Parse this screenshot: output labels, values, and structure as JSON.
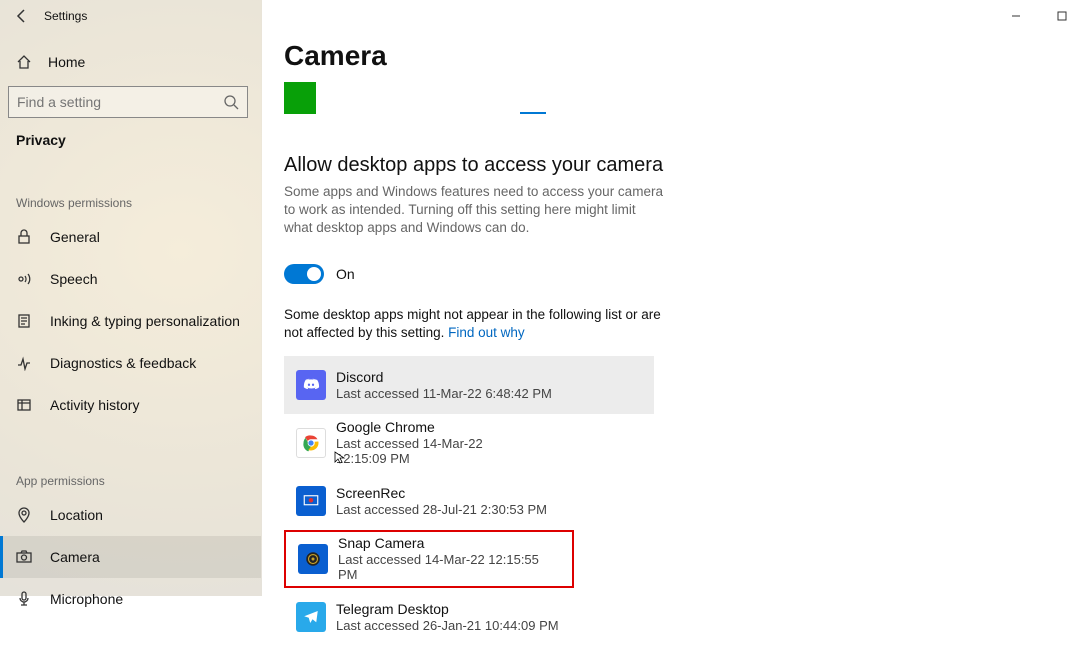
{
  "appTitle": "Settings",
  "home": "Home",
  "search": {
    "placeholder": "Find a setting"
  },
  "currentCategory": "Privacy",
  "section1": {
    "header": "Windows permissions",
    "items": [
      "General",
      "Speech",
      "Inking & typing personalization",
      "Diagnostics & feedback",
      "Activity history"
    ]
  },
  "section2": {
    "header": "App permissions",
    "items": [
      "Location",
      "Camera",
      "Microphone"
    ],
    "selectedIndex": 1
  },
  "page": {
    "title": "Camera",
    "sectionTitle": "Allow desktop apps to access your camera",
    "sectionDesc": "Some apps and Windows features need to access your camera to work as intended. Turning off this setting here might limit what desktop apps and Windows can do.",
    "toggleLabel": "On",
    "noteBefore": "Some desktop apps might not appear in the following list or are not affected by this setting. ",
    "noteLink": "Find out why"
  },
  "apps": [
    {
      "name": "Discord",
      "sub": "Last accessed 11-Mar-22 6:48:42 PM"
    },
    {
      "name": "Google Chrome",
      "sub": "Last accessed 14-Mar-22 12:15:09 PM"
    },
    {
      "name": "ScreenRec",
      "sub": "Last accessed 28-Jul-21 2:30:53 PM"
    },
    {
      "name": "Snap Camera",
      "sub": "Last accessed 14-Mar-22 12:15:55 PM"
    },
    {
      "name": "Telegram Desktop",
      "sub": "Last accessed 26-Jan-21 10:44:09 PM"
    }
  ]
}
